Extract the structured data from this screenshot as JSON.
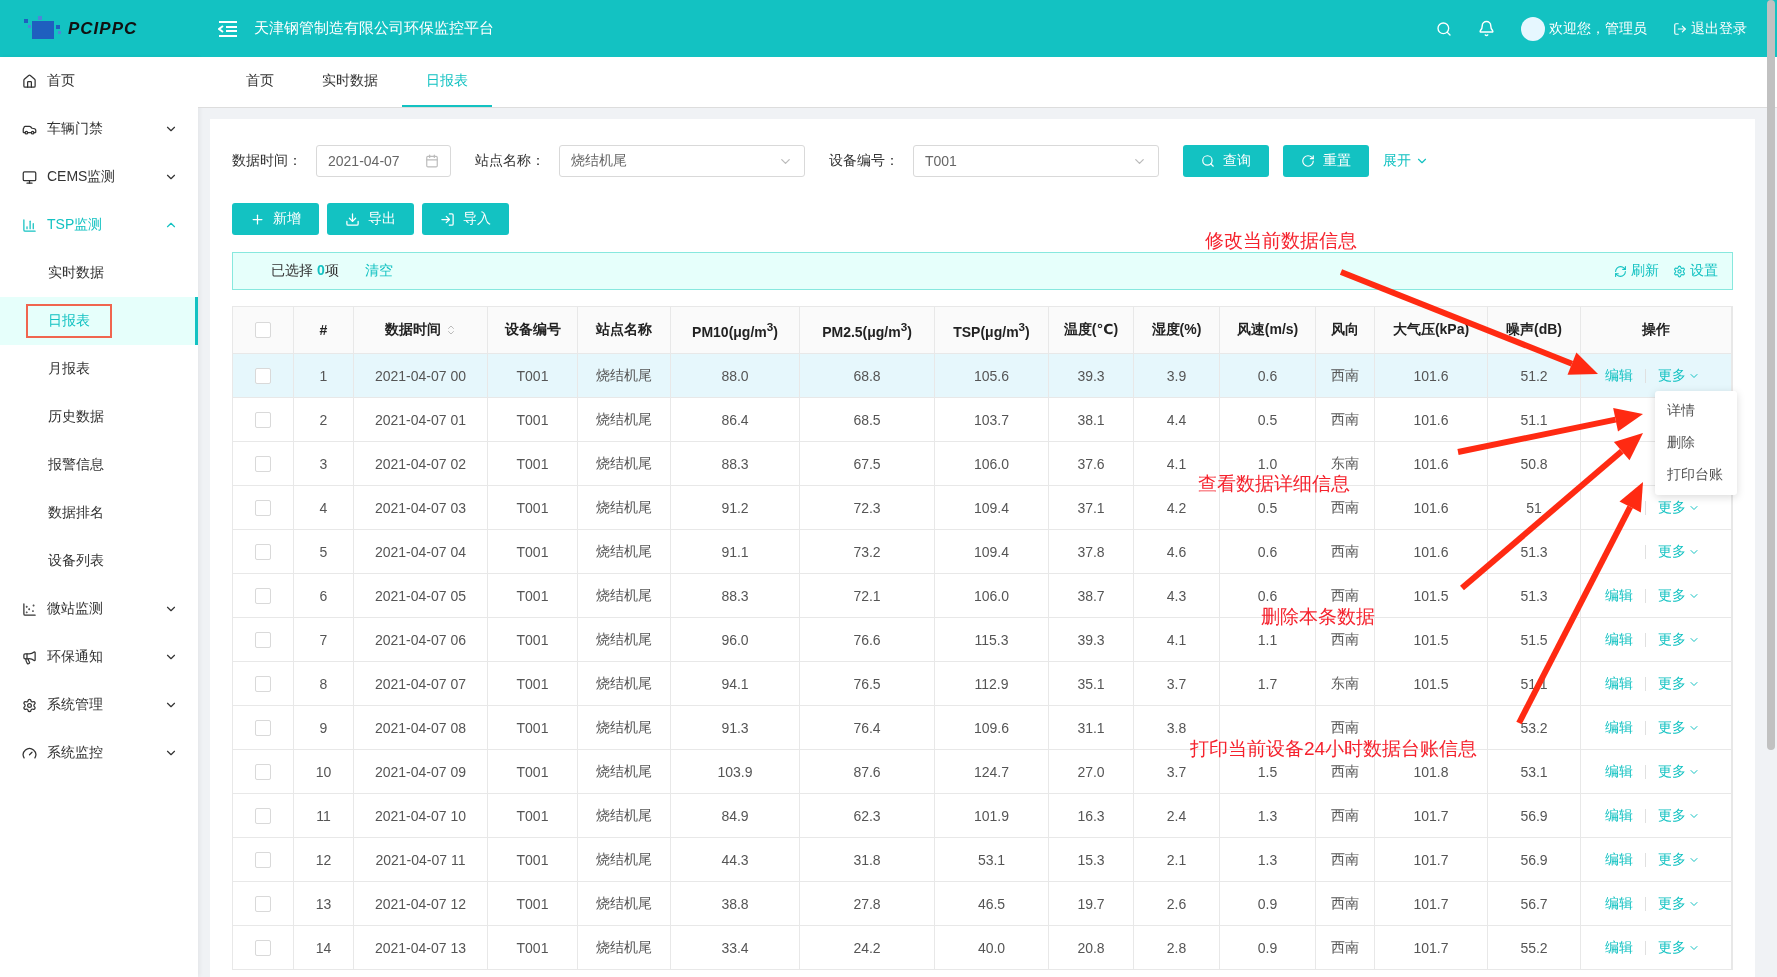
{
  "header": {
    "logo": "PCIPPC",
    "title": "天津钢管制造有限公司环保监控平台",
    "welcome": "欢迎您，管理员",
    "logout": "退出登录"
  },
  "sidebar": {
    "items": [
      {
        "label": "首页",
        "expanded": false,
        "has_children": false
      },
      {
        "label": "车辆门禁",
        "expanded": false,
        "has_children": true
      },
      {
        "label": "CEMS监测",
        "expanded": false,
        "has_children": true
      },
      {
        "label": "TSP监测",
        "expanded": true,
        "has_children": true,
        "children": [
          {
            "label": "实时数据",
            "selected": false,
            "marked": false
          },
          {
            "label": "日报表",
            "selected": true,
            "marked": true
          },
          {
            "label": "月报表",
            "selected": false,
            "marked": false
          },
          {
            "label": "历史数据",
            "selected": false,
            "marked": false
          },
          {
            "label": "报警信息",
            "selected": false,
            "marked": false
          },
          {
            "label": "数据排名",
            "selected": false,
            "marked": false
          },
          {
            "label": "设备列表",
            "selected": false,
            "marked": false
          }
        ]
      },
      {
        "label": "微站监测",
        "expanded": false,
        "has_children": true
      },
      {
        "label": "环保通知",
        "expanded": false,
        "has_children": true
      },
      {
        "label": "系统管理",
        "expanded": false,
        "has_children": true
      },
      {
        "label": "系统监控",
        "expanded": false,
        "has_children": true
      }
    ]
  },
  "tabs": [
    {
      "label": "首页",
      "selected": false
    },
    {
      "label": "实时数据",
      "selected": false
    },
    {
      "label": "日报表",
      "selected": true
    }
  ],
  "filters": [
    {
      "kind": "date",
      "label": "数据时间：",
      "value": "2021-04-07"
    },
    {
      "kind": "select",
      "label": "站点名称：",
      "value": "烧结机尾"
    },
    {
      "kind": "select",
      "label": "设备编号：",
      "value": "T001"
    }
  ],
  "search_buttons": [
    {
      "kind": "search",
      "label": "查询"
    },
    {
      "kind": "reset",
      "label": "重置"
    }
  ],
  "expand_link": "展开",
  "toolbar": [
    {
      "kind": "add",
      "label": "新增"
    },
    {
      "kind": "export",
      "label": "导出"
    },
    {
      "kind": "import",
      "label": "导入"
    }
  ],
  "selection_bar": {
    "text": "已选择 **0**项",
    "clear": "清空",
    "refresh": "刷新",
    "settings": "设置"
  },
  "table": {
    "header_checked": false,
    "columns": [
      {
        "label": "#"
      },
      {
        "label": "数据时间",
        "sortable": true
      },
      {
        "label": "设备编号"
      },
      {
        "label": "站点名称"
      },
      {
        "label": "PM10(μg/m$^{3}$)"
      },
      {
        "label": "PM2.5(μg/m$^{3}$)"
      },
      {
        "label": "TSP(μg/m$^{3}$)"
      },
      {
        "label": "温度(℃)"
      },
      {
        "label": "湿度(%)"
      },
      {
        "label": "风速(m/s)"
      },
      {
        "label": "风向"
      },
      {
        "label": "大气压(kPa)"
      },
      {
        "label": "噪声(dB)"
      },
      {
        "label": "操作"
      }
    ],
    "rows": [
      {
        "checked": false,
        "highlighted": true,
        "cells": [
          "1",
          "2021-04-07 00",
          "T001",
          "烧结机尾",
          "88.0",
          "68.8",
          "105.6",
          "39.3",
          "3.9",
          "0.6",
          "西南",
          "101.6",
          "51.2"
        ],
        "actions": [
          "编辑",
          "更多"
        ],
        "menu": [
          "详情",
          "删除",
          "打印台账"
        ]
      },
      {
        "checked": false,
        "highlighted": false,
        "cells": [
          "2",
          "2021-04-07 01",
          "T001",
          "烧结机尾",
          "86.4",
          "68.5",
          "103.7",
          "38.1",
          "4.4",
          "0.5",
          "西南",
          "101.6",
          "51.1"
        ]
      },
      {
        "checked": false,
        "highlighted": false,
        "cells": [
          "3",
          "2021-04-07 02",
          "T001",
          "烧结机尾",
          "88.3",
          "67.5",
          "106.0",
          "37.6",
          "4.1",
          "1.0",
          "东南",
          "101.6",
          "50.8"
        ]
      },
      {
        "checked": false,
        "highlighted": false,
        "cells": [
          "4",
          "2021-04-07 03",
          "T001",
          "烧结机尾",
          "91.2",
          "72.3",
          "109.4",
          "37.1",
          "4.2",
          "0.5",
          "西南",
          "101.6",
          "51"
        ],
        "actions": [
          {
            "kind": "more",
            "label": "更多"
          }
        ]
      },
      {
        "checked": false,
        "highlighted": false,
        "cells": [
          "5",
          "2021-04-07 04",
          "T001",
          "烧结机尾",
          "91.1",
          "73.2",
          "109.4",
          "37.8",
          "4.6",
          "0.6",
          "西南",
          "101.6",
          "51.3"
        ],
        "actions": [
          {
            "kind": "more",
            "label": "更多"
          }
        ]
      },
      {
        "checked": false,
        "highlighted": false,
        "cells": [
          "6",
          "2021-04-07 05",
          "T001",
          "烧结机尾",
          "88.3",
          "72.1",
          "106.0",
          "38.7",
          "4.3",
          "0.6",
          "西南",
          "101.5",
          "51.3"
        ],
        "actions": [
          "编辑",
          "更多"
        ]
      },
      {
        "checked": false,
        "highlighted": false,
        "cells": [
          "7",
          "2021-04-07 06",
          "T001",
          "烧结机尾",
          "96.0",
          "76.6",
          "115.3",
          "39.3",
          "4.1",
          "1.1",
          "西南",
          "101.5",
          "51.5"
        ],
        "actions": [
          "编辑",
          "更多"
        ]
      },
      {
        "checked": false,
        "highlighted": false,
        "cells": [
          "8",
          "2021-04-07 07",
          "T001",
          "烧结机尾",
          "94.1",
          "76.5",
          "112.9",
          "35.1",
          "3.7",
          "1.7",
          "东南",
          "101.5",
          "51.1"
        ],
        "actions": [
          "编辑",
          "更多"
        ]
      },
      {
        "checked": false,
        "highlighted": false,
        "cells": [
          "9",
          "2021-04-07 08",
          "T001",
          "烧结机尾",
          "91.3",
          "76.4",
          "109.6",
          "31.1",
          "3.8",
          null,
          "西南",
          null,
          "53.2"
        ],
        "actions": [
          "编辑",
          "更多"
        ]
      },
      {
        "checked": false,
        "highlighted": false,
        "cells": [
          "10",
          "2021-04-07 09",
          "T001",
          "烧结机尾",
          "103.9",
          "87.6",
          "124.7",
          "27.0",
          "3.7",
          "1.5",
          "西南",
          "101.8",
          "53.1"
        ],
        "actions": [
          "编辑",
          "更多"
        ]
      },
      {
        "checked": false,
        "highlighted": false,
        "cells": [
          "11",
          "2021-04-07 10",
          "T001",
          "烧结机尾",
          "84.9",
          "62.3",
          "101.9",
          "16.3",
          "2.4",
          "1.3",
          "西南",
          "101.7",
          "56.9"
        ],
        "actions": [
          "编辑",
          "更多"
        ]
      },
      {
        "checked": false,
        "highlighted": false,
        "cells": [
          "12",
          "2021-04-07 11",
          "T001",
          "烧结机尾",
          "44.3",
          "31.8",
          "53.1",
          "15.3",
          "2.1",
          "1.3",
          "西南",
          "101.7",
          "56.9"
        ],
        "actions": [
          "编辑",
          "更多"
        ]
      },
      {
        "checked": false,
        "highlighted": false,
        "cells": [
          "13",
          "2021-04-07 12",
          "T001",
          "烧结机尾",
          "38.8",
          "27.8",
          "46.5",
          "19.7",
          "2.6",
          "0.9",
          "西南",
          "101.7",
          "56.7"
        ],
        "actions": [
          "编辑",
          "更多"
        ]
      },
      {
        "checked": false,
        "highlighted": false,
        "cells": [
          "14",
          "2021-04-07 13",
          "T001",
          "烧结机尾",
          "33.4",
          "24.2",
          "40.0",
          "20.8",
          "2.8",
          "0.9",
          "西南",
          "101.7",
          "55.2"
        ],
        "actions": [
          "编辑",
          "更多"
        ]
      }
    ]
  },
  "annotations": [
    {
      "text": "修改当前数据信息"
    },
    {
      "text": "查看数据详细信息"
    },
    {
      "text": "删除本条数据"
    },
    {
      "text": "打印当前设备24小时数据台账信息"
    }
  ]
}
